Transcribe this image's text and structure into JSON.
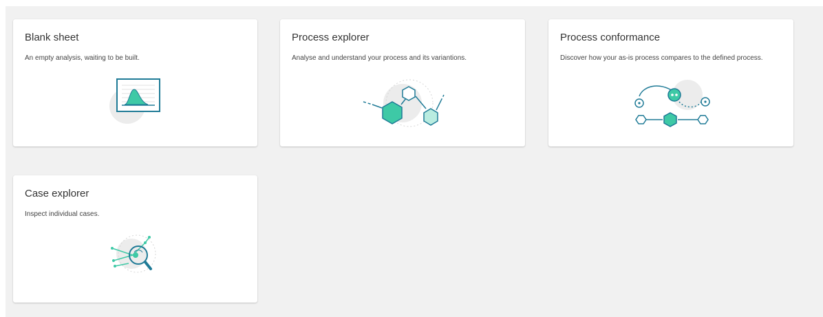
{
  "cards": [
    {
      "title": "Blank sheet",
      "description": "An empty analysis, waiting to be built.",
      "illustration": "blank-sheet-illustration"
    },
    {
      "title": "Process explorer",
      "description": "Analyse and understand your process and its variantions.",
      "illustration": "process-explorer-illustration"
    },
    {
      "title": "Process conformance",
      "description": "Discover how your as-is process compares to the defined process.",
      "illustration": "process-conformance-illustration"
    },
    {
      "title": "Case explorer",
      "description": "Inspect individual cases.",
      "illustration": "case-explorer-illustration"
    }
  ],
  "colors": {
    "background": "#f1f1f1",
    "card": "#ffffff",
    "accent_teal": "#3ec9a6",
    "accent_light": "#b9ece0",
    "outline_blue": "#1e7a96",
    "blob_grey": "#ececec"
  }
}
